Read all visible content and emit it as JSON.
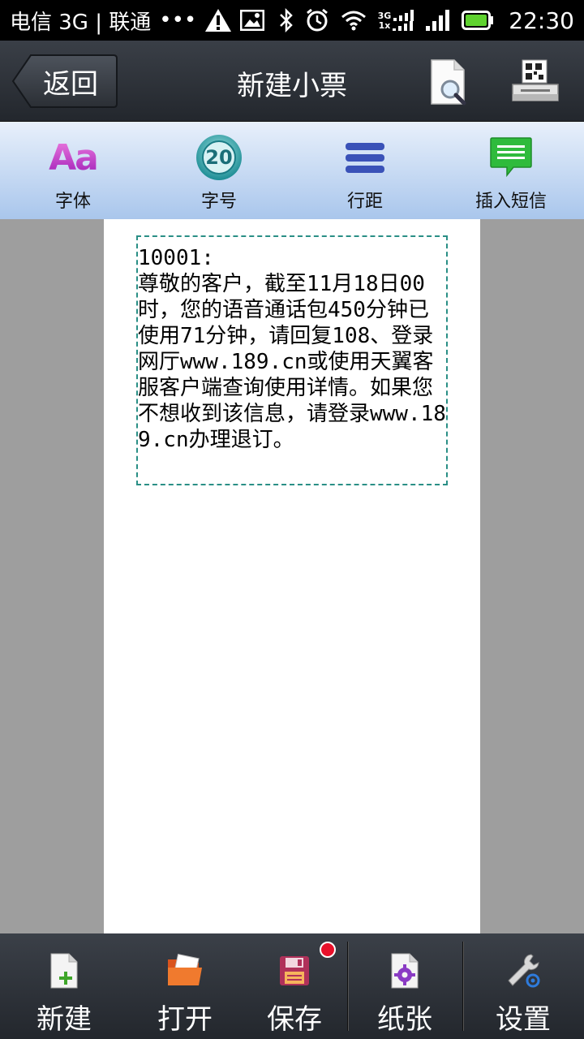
{
  "status_bar": {
    "carrier": "电信 3G | 联通",
    "dots": "•••",
    "network_label_top": "3G",
    "network_label_bottom": "1x",
    "time": "22:30"
  },
  "header": {
    "back_label": "返回",
    "title": "新建小票",
    "preview_icon": "document-search-icon",
    "print_icon": "printer-icon"
  },
  "toolbar": {
    "items": [
      {
        "label": "字体",
        "icon": "font-icon",
        "glyph": "Aa"
      },
      {
        "label": "字号",
        "icon": "font-size-icon",
        "glyph": "20"
      },
      {
        "label": "行距",
        "icon": "line-spacing-icon"
      },
      {
        "label": "插入短信",
        "icon": "insert-sms-icon"
      }
    ]
  },
  "ticket": {
    "text": "10001:\n尊敬的客户，截至11月18日00时，您的语音通话包450分钟已使用71分钟，请回复108、登录网厅www.189.cn或使用天翼客服客户端查询使用详情。如果您不想收到该信息，请登录www.189.cn办理退订。"
  },
  "bottom_bar": {
    "items": [
      {
        "label": "新建",
        "icon": "new-file-icon"
      },
      {
        "label": "打开",
        "icon": "open-folder-icon"
      },
      {
        "label": "保存",
        "icon": "save-icon"
      },
      {
        "label": "纸张",
        "icon": "paper-settings-icon"
      },
      {
        "label": "设置",
        "icon": "wrench-settings-icon"
      }
    ]
  },
  "colors": {
    "toolbar_gradient_top": "#e8f0fb",
    "toolbar_gradient_bottom": "#a9c6ec",
    "textbox_border": "#2a8f86",
    "notification_dot": "#e8102a"
  }
}
